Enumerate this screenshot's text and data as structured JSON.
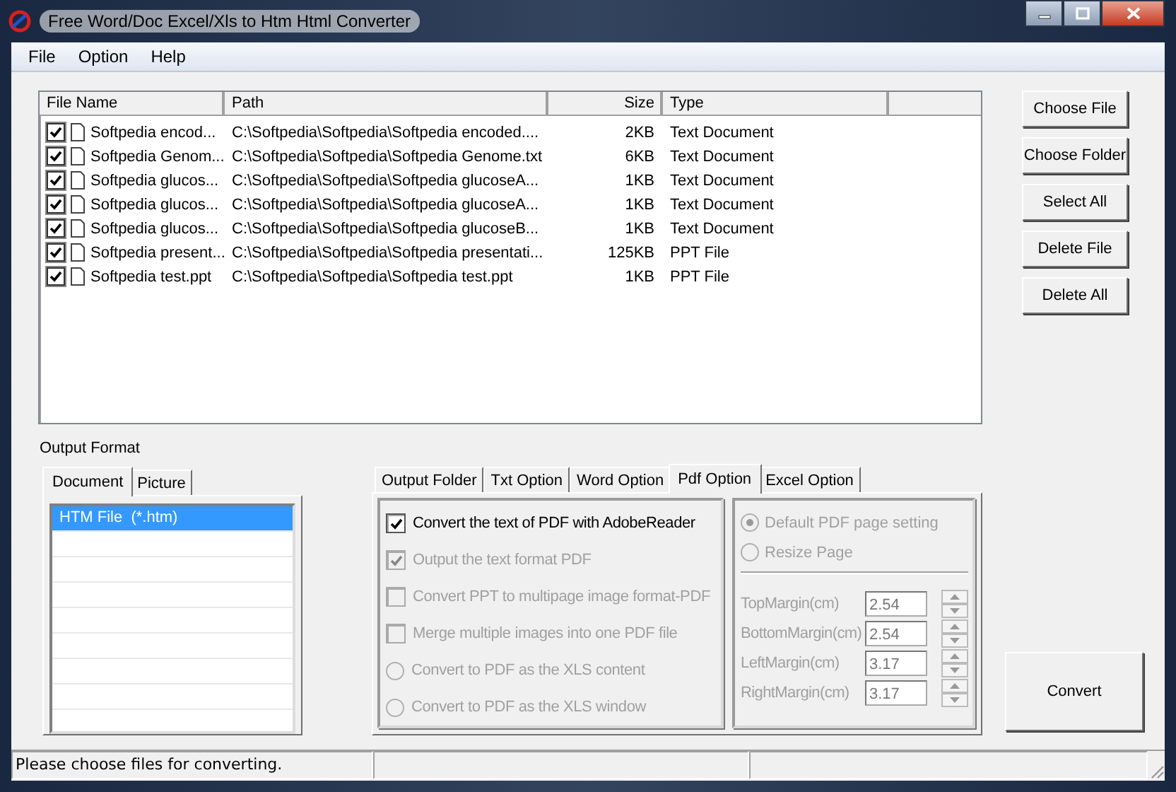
{
  "window": {
    "title": "Free Word/Doc Excel/Xls to Htm Html Converter"
  },
  "menu": [
    "File",
    "Option",
    "Help"
  ],
  "file_list": {
    "columns": [
      {
        "label": "File Name"
      },
      {
        "label": "Path"
      },
      {
        "label": "Size"
      },
      {
        "label": "Type"
      }
    ],
    "rows": [
      {
        "checked": true,
        "name": "Softpedia encod...",
        "path": "C:\\Softpedia\\Softpedia\\Softpedia encoded....",
        "size": "2KB",
        "type": "Text Document"
      },
      {
        "checked": true,
        "name": "Softpedia Genom...",
        "path": "C:\\Softpedia\\Softpedia\\Softpedia Genome.txt",
        "size": "6KB",
        "type": "Text Document"
      },
      {
        "checked": true,
        "name": "Softpedia glucos...",
        "path": "C:\\Softpedia\\Softpedia\\Softpedia glucoseA...",
        "size": "1KB",
        "type": "Text Document"
      },
      {
        "checked": true,
        "name": "Softpedia glucos...",
        "path": "C:\\Softpedia\\Softpedia\\Softpedia glucoseA...",
        "size": "1KB",
        "type": "Text Document"
      },
      {
        "checked": true,
        "name": "Softpedia glucos...",
        "path": "C:\\Softpedia\\Softpedia\\Softpedia glucoseB...",
        "size": "1KB",
        "type": "Text Document"
      },
      {
        "checked": true,
        "name": "Softpedia present...",
        "path": "C:\\Softpedia\\Softpedia\\Softpedia presentati...",
        "size": "125KB",
        "type": "PPT File"
      },
      {
        "checked": true,
        "name": "Softpedia test.ppt",
        "path": "C:\\Softpedia\\Softpedia\\Softpedia test.ppt",
        "size": "1KB",
        "type": "PPT File"
      }
    ]
  },
  "side_buttons": [
    "Choose File",
    "Choose Folder",
    "Select All",
    "Delete File",
    "Delete All"
  ],
  "output_format": {
    "label": "Output Format",
    "tabs": [
      {
        "label": "Document",
        "selected": true
      },
      {
        "label": "Picture",
        "selected": false
      }
    ],
    "items": [
      {
        "label": "HTM File  (*.htm)",
        "selected": true
      }
    ]
  },
  "option_tabs": [
    {
      "label": "Output Folder",
      "selected": false
    },
    {
      "label": "Txt Option",
      "selected": false
    },
    {
      "label": "Word Option",
      "selected": false
    },
    {
      "label": "Pdf Option",
      "selected": true
    },
    {
      "label": "Excel Option",
      "selected": false
    }
  ],
  "pdf_options": [
    {
      "kind": "checkbox",
      "label": "Convert the text of PDF with AdobeReader",
      "checked": true,
      "disabled": false
    },
    {
      "kind": "checkbox",
      "label": "Output the text format PDF",
      "checked": true,
      "disabled": true
    },
    {
      "kind": "checkbox",
      "label": "Convert PPT to multipage image format-PDF",
      "checked": false,
      "disabled": true
    },
    {
      "kind": "checkbox",
      "label": "Merge multiple images into one PDF file",
      "checked": false,
      "disabled": true
    },
    {
      "kind": "radio",
      "label": "Convert to PDF as the XLS content",
      "checked": false,
      "disabled": true
    },
    {
      "kind": "radio",
      "label": "Convert to PDF as the XLS window",
      "checked": false,
      "disabled": true
    }
  ],
  "page_setting": [
    {
      "label": "Default PDF page setting",
      "selected": true
    },
    {
      "label": "Resize Page",
      "selected": false
    }
  ],
  "margins": [
    {
      "label": "TopMargin(cm)",
      "value": "2.54"
    },
    {
      "label": "BottomMargin(cm)",
      "value": "2.54"
    },
    {
      "label": "LeftMargin(cm)",
      "value": "3.17"
    },
    {
      "label": "RightMargin(cm)",
      "value": "3.17"
    }
  ],
  "convert_button": "Convert",
  "status_bar": "Please choose files for converting."
}
